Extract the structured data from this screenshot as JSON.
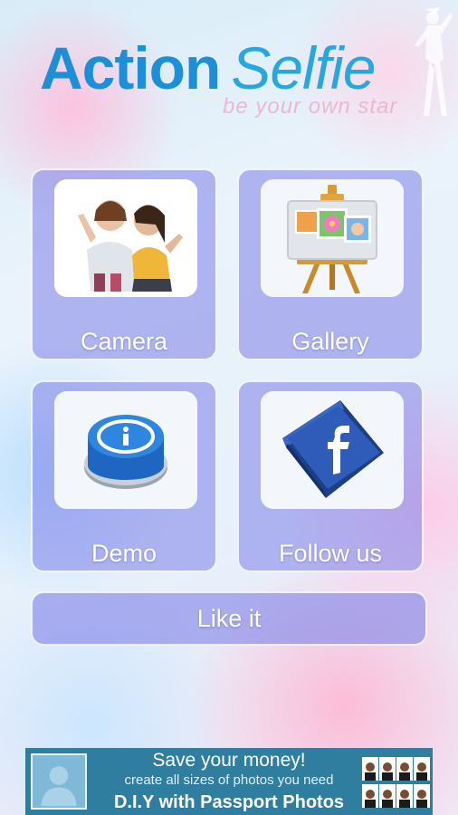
{
  "app": {
    "logo_word1": "Action",
    "logo_word2": "Selfie",
    "tagline": "be your own star"
  },
  "menu": [
    {
      "id": "camera",
      "label": "Camera",
      "icon": "selfie-photo-icon"
    },
    {
      "id": "gallery",
      "label": "Gallery",
      "icon": "easel-gallery-icon"
    },
    {
      "id": "demo",
      "label": "Demo",
      "icon": "info-button-icon"
    },
    {
      "id": "follow",
      "label": "Follow us",
      "icon": "facebook-icon"
    }
  ],
  "like": {
    "label": "Like it"
  },
  "ad": {
    "line1": "Save your money!",
    "line2": "create all sizes of photos you need",
    "line3": "D.I.Y with Passport Photos"
  },
  "colors": {
    "tile": "#7e80e8",
    "logo_blue": "#1c8fd8",
    "tagline_pink": "#e9b9d0",
    "ad_background": "#2f7ea0"
  }
}
